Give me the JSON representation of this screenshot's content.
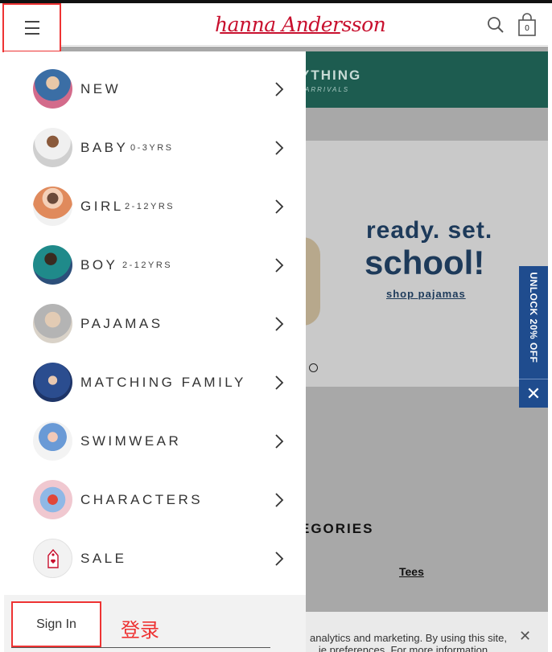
{
  "header": {
    "logo_text": "hanna Andersson",
    "cart_count": "0",
    "brand_color": "#c8102e"
  },
  "background": {
    "promo_line1": "YTHING",
    "promo_line2": "ARRIVALS",
    "hero_line1": "ready. set.",
    "hero_line2": "school!",
    "hero_link": "shop pajamas",
    "unlock_label": "UNLOCK 20% OFF",
    "categories_title": "EGORIES",
    "tees_link": "Tees",
    "cookie_text": "analytics and marketing. By using this site, ...ie preferences. For more information, view"
  },
  "drawer": {
    "items": [
      {
        "label": "NEW",
        "sub": ""
      },
      {
        "label": "BABY",
        "sub": "0-3YRS"
      },
      {
        "label": "GIRL",
        "sub": "2-12YRS"
      },
      {
        "label": "BOY",
        "sub": "2-12YRS"
      },
      {
        "label": "PAJAMAS",
        "sub": ""
      },
      {
        "label": "MATCHING FAMILY",
        "sub": ""
      },
      {
        "label": "SWIMWEAR",
        "sub": ""
      },
      {
        "label": "CHARACTERS",
        "sub": ""
      },
      {
        "label": "SALE",
        "sub": ""
      }
    ],
    "sign_in": "Sign In",
    "annotation": "登录"
  },
  "icons": {
    "menu": "hamburger-icon",
    "search": "search-icon",
    "bag": "shopping-bag-icon",
    "chevron": "chevron-right-icon",
    "close": "close-icon"
  }
}
